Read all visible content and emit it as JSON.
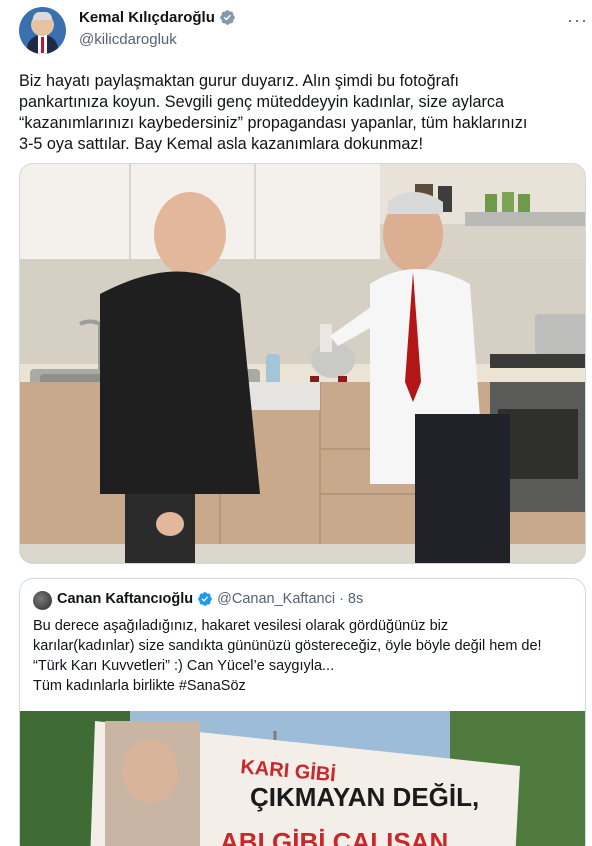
{
  "author": {
    "display_name": "Kemal Kılıçdaroğlu",
    "handle": "@kilicdarogluk",
    "verified": true,
    "avatar_icon": "profile-avatar"
  },
  "more_icon": "more-options-icon",
  "tweet": {
    "lines": [
      "Biz hayatı paylaşmaktan gurur duyarız. Alın şimdi bu fotoğrafı",
      "pankartınıza koyun. Sevgili genç müteddeyyin kadınlar, size aylarca",
      "“kazanımlarınızı kaybedersiniz” propagandası yapanlar, tüm haklarınızı",
      "3-5 oya sattılar. Bay Kemal asla kazanımlara dokunmaz!"
    ]
  },
  "quote": {
    "display_name": "Canan Kaftancıoğlu",
    "handle": "@Canan_Kaftanci",
    "separator": "·",
    "time": "8s",
    "verified": true,
    "lines": [
      "Bu derece aşağıladığınız, hakaret vesilesi olarak gördüğünüz biz",
      "karılar(kadınlar) size sandıkta gününüzü göstereceğiz, öyle böyle değil hem de!",
      "“Türk Karı Kuvvetleri” :) Can Yücel’e saygıyla...",
      "Tüm kadınlarla birlikte #SanaSöz"
    ],
    "banner_text": [
      "KARI GİBİ",
      "ÇIKMAYAN DEĞİL,",
      "ABI GİBİ ÇALIŞAN"
    ]
  },
  "colors": {
    "text": "#0f1419",
    "secondary": "#536471",
    "verified": "#829aab",
    "border": "#cfd9de"
  }
}
